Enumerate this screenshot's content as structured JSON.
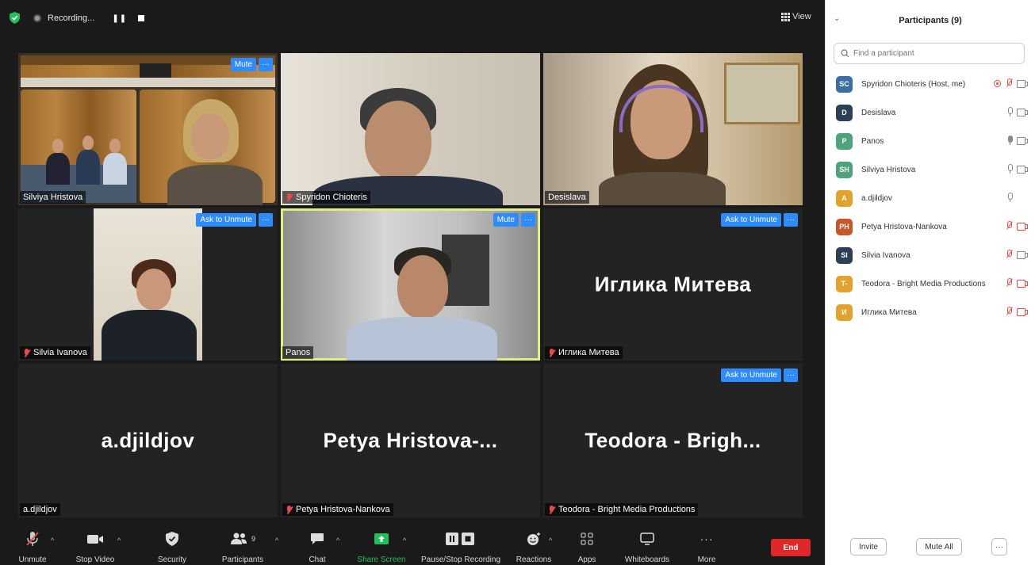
{
  "topbar": {
    "recording_label": "Recording...",
    "view_label": "View"
  },
  "tiles": [
    {
      "name": "Silviya Hristova",
      "muted": false,
      "button": "Mute",
      "big": ""
    },
    {
      "name": "Spyridon Chioteris",
      "muted": true,
      "button": "",
      "big": ""
    },
    {
      "name": "Desislava",
      "muted": false,
      "button": "",
      "big": ""
    },
    {
      "name": "Silvia Ivanova",
      "muted": true,
      "button": "Ask to Unmute",
      "big": ""
    },
    {
      "name": "Panos",
      "muted": false,
      "button": "Mute",
      "big": ""
    },
    {
      "name": "Иглика Митева",
      "muted": true,
      "button": "Ask to Unmute",
      "big": "Иглика Митева"
    },
    {
      "name": "a.djildjov",
      "muted": false,
      "button": "",
      "big": "a.djildjov"
    },
    {
      "name": "Petya Hristova-Nankova",
      "muted": true,
      "button": "",
      "big": "Petya  Hristova-..."
    },
    {
      "name": "Teodora - Bright Media Productions",
      "muted": true,
      "button": "Ask to Unmute",
      "big": "Teodora  -  Brigh..."
    }
  ],
  "toolbar": {
    "unmute": "Unmute",
    "stop_video": "Stop Video",
    "security": "Security",
    "participants": "Participants",
    "participants_count": "9",
    "chat": "Chat",
    "share_screen": "Share Screen",
    "pause_stop_recording": "Pause/Stop Recording",
    "reactions": "Reactions",
    "apps": "Apps",
    "whiteboards": "Whiteboards",
    "more": "More",
    "end": "End"
  },
  "panel": {
    "title": "Participants (9)",
    "search_placeholder": "Find a participant",
    "invite": "Invite",
    "mute_all": "Mute All",
    "more": "···",
    "participants": [
      {
        "initials": "SC",
        "name": "Spyridon Chioteris (Host, me)",
        "color": "#3a6ea5",
        "mic": "off",
        "cam": "on",
        "rec": true
      },
      {
        "initials": "D",
        "name": "Desislava",
        "color": "#2b3f57",
        "mic": "on",
        "cam": "on",
        "rec": false
      },
      {
        "initials": "P",
        "name": "Panos",
        "color": "#4fa37a",
        "mic": "live",
        "cam": "on",
        "rec": false
      },
      {
        "initials": "SH",
        "name": "Silviya Hristova",
        "color": "#4fa37a",
        "mic": "on",
        "cam": "on",
        "rec": false
      },
      {
        "initials": "A",
        "name": "a.djildjov",
        "color": "#e3a22c",
        "mic": "on",
        "cam": "none",
        "rec": false
      },
      {
        "initials": "PH",
        "name": "Petya Hristova-Nankova",
        "color": "#c8562a",
        "mic": "off",
        "cam": "off",
        "rec": false
      },
      {
        "initials": "SI",
        "name": "Silvia Ivanova",
        "color": "#2b3f57",
        "mic": "off",
        "cam": "on",
        "rec": false
      },
      {
        "initials": "T-",
        "name": "Teodora - Bright Media Productions",
        "color": "#e3a22c",
        "mic": "off",
        "cam": "off",
        "rec": false
      },
      {
        "initials": "И",
        "name": "Иглика Митева",
        "color": "#e3a22c",
        "mic": "off",
        "cam": "off",
        "rec": false
      }
    ]
  },
  "colors": {
    "accent": "#2d8cff",
    "active_speaker": "#dff07c",
    "end_red": "#e02828",
    "share_green": "#21c05a"
  }
}
